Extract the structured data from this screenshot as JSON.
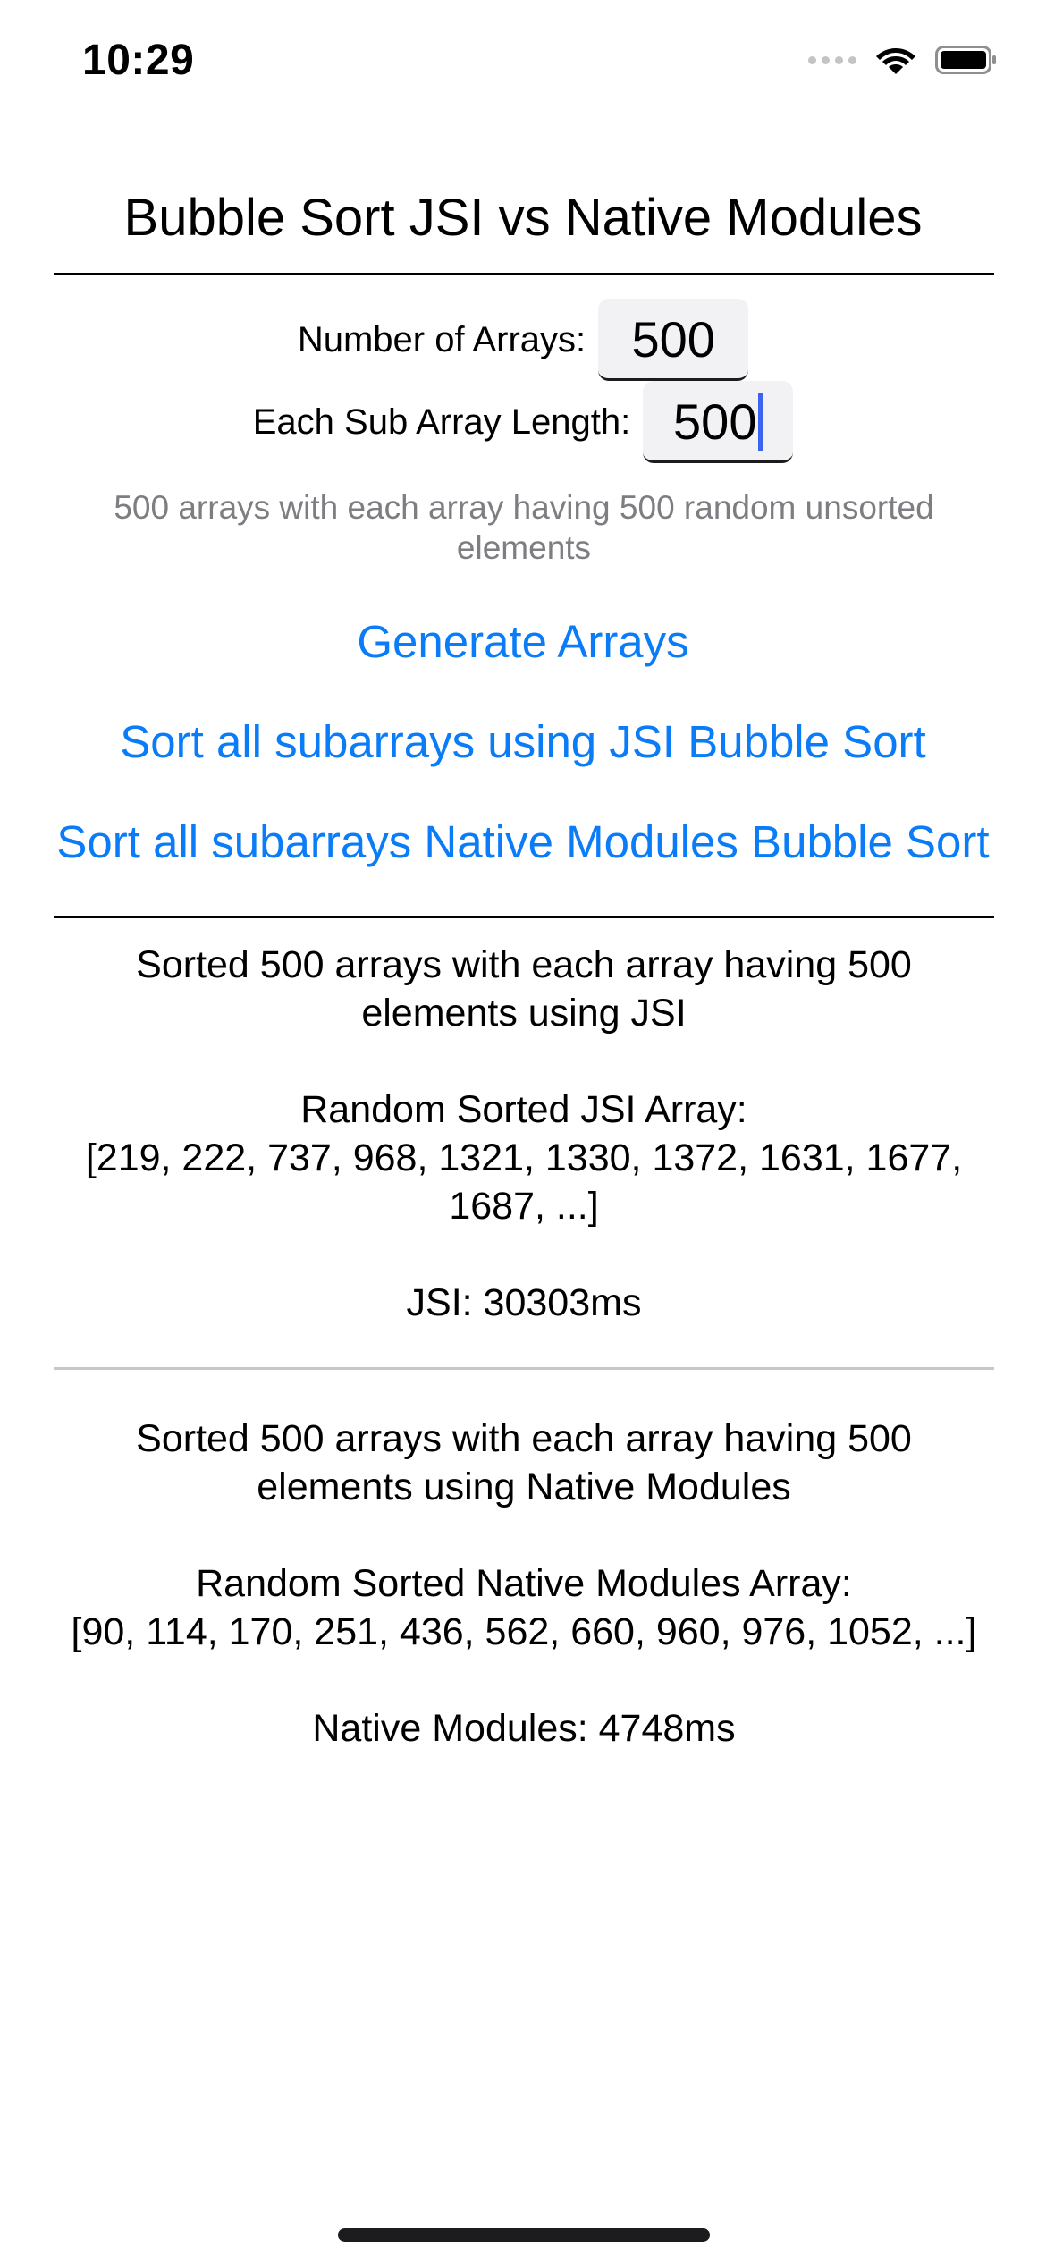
{
  "status_bar": {
    "time": "10:29",
    "icons": [
      "cellular-dots-icon",
      "wifi-icon",
      "battery-icon"
    ]
  },
  "title": "Bubble Sort JSI vs Native Modules",
  "inputs": {
    "num_arrays_label": "Number of Arrays:",
    "num_arrays_value": "500",
    "sub_array_length_label": "Each Sub Array Length:",
    "sub_array_length_value": "500"
  },
  "hint": "500 arrays with each array having 500 random unsorted elements",
  "buttons": {
    "generate": "Generate Arrays",
    "sort_jsi": "Sort all subarrays using JSI Bubble Sort",
    "sort_native": "Sort all subarrays Native Modules Bubble Sort"
  },
  "jsi_result": {
    "summary": "Sorted 500 arrays with each array having 500 elements using JSI",
    "array_label": "Random Sorted JSI Array:",
    "array_values": "[219, 222, 737, 968, 1321, 1330, 1372, 1631, 1677, 1687, ...]",
    "timing": "JSI: 30303ms"
  },
  "native_result": {
    "summary": "Sorted 500 arrays with each array having 500 elements using Native Modules",
    "array_label": "Random Sorted Native Modules Array:",
    "array_values": "[90, 114, 170, 251, 436, 562, 660, 960, 976, 1052, ...]",
    "timing": "Native Modules: 4748ms"
  },
  "colors": {
    "link": "#0a7cf7",
    "hint_text": "#7d7d82",
    "caret": "#3d64f0",
    "input_bg": "#f2f2f4"
  }
}
